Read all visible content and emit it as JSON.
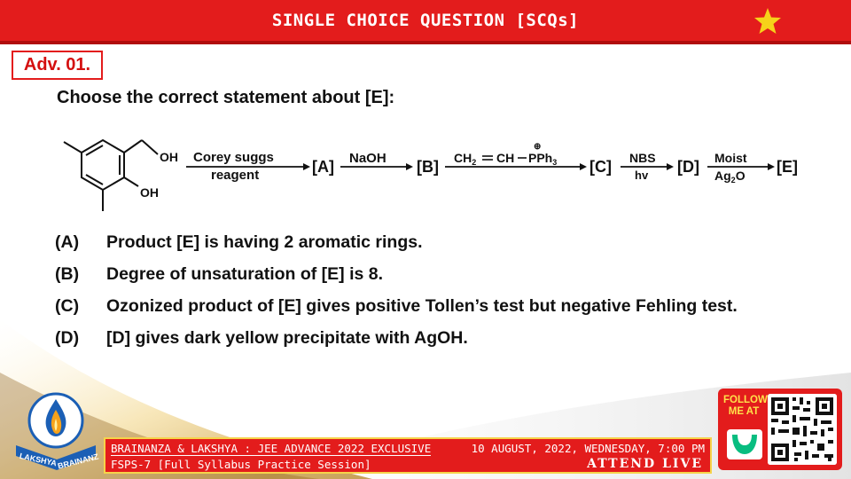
{
  "header": {
    "title": "SINGLE CHOICE QUESTION [SCQs]"
  },
  "question": {
    "label": "Adv. 01.",
    "prompt": "Choose the correct statement about [E]:",
    "scheme": {
      "substituent_oh1": "OH",
      "substituent_oh2": "OH",
      "step1_top": "Corey suggs",
      "step1_bottom": "reagent",
      "product_a": "[A]",
      "step2_top": "NaOH",
      "product_b": "[B]",
      "step3_left": "CH",
      "step3_sub": "2",
      "step3_mid": "CH",
      "step3_right": "PPh",
      "step3_sub2": "3",
      "step3_charge": "⊕",
      "product_c": "[C]",
      "step4_top": "NBS",
      "step4_bottom": "hv",
      "product_d": "[D]",
      "step5_top": "Moist",
      "step5_bottom_a": "Ag",
      "step5_bottom_sub": "2",
      "step5_bottom_b": "O",
      "product_e": "[E]"
    },
    "options": [
      {
        "label": "(A)",
        "text": "Product [E] is having 2 aromatic rings."
      },
      {
        "label": "(B)",
        "text": "Degree of unsaturation of [E] is 8."
      },
      {
        "label": "(C)",
        "text": "Ozonized product of [E] gives positive Tollen’s test but negative Fehling test."
      },
      {
        "label": "(D)",
        "text": "[D] gives dark yellow precipitate with AgOH."
      }
    ]
  },
  "footer": {
    "line1_left": "BRAINANZA & LAKSHYA : JEE ADVANCE 2022 EXCLUSIVE",
    "line1_right": "10 AUGUST, 2022, WEDNESDAY, 7:00 PM",
    "line2": "FSPS-7 [Full Syllabus Practice Session]",
    "live": "ATTEND LIVE"
  },
  "logo": {
    "text_left": "LAKSHYA",
    "text_right": "BRAINANZA"
  },
  "follow": {
    "line1": "FOLLOW",
    "line2": "ME AT"
  },
  "colors": {
    "accent": "#e31c1c",
    "star": "#f6d21a",
    "footer_border": "#f6d34a"
  },
  "icons": {
    "star": "star-icon",
    "logo": "lakshya-brainanza-logo",
    "qr": "qr-code",
    "follow_brand": "unacademy-icon"
  }
}
